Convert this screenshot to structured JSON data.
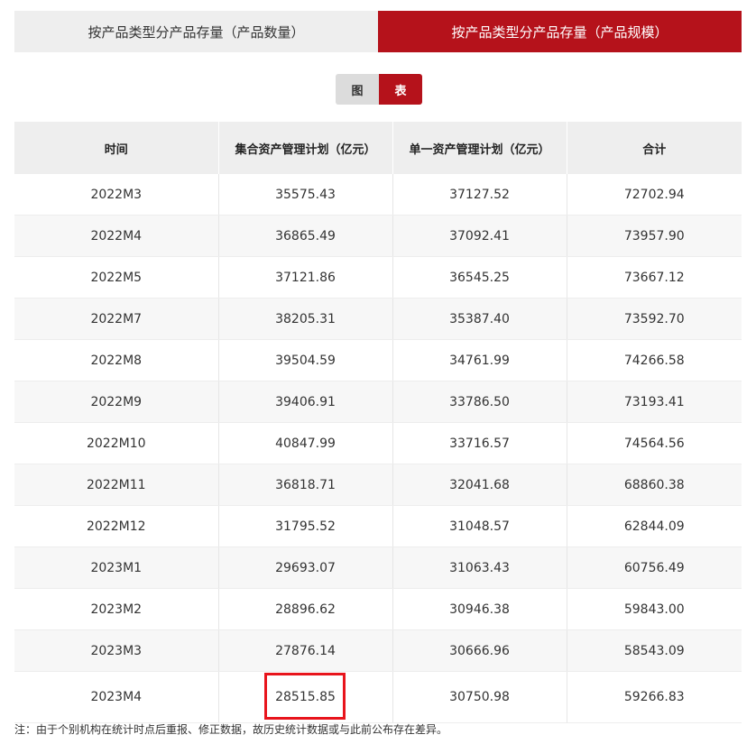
{
  "tabs": [
    {
      "label": "按产品类型分产品存量（产品数量）",
      "active": false
    },
    {
      "label": "按产品类型分产品存量（产品规模）",
      "active": true
    }
  ],
  "view_toggle": {
    "chart_label": "图",
    "table_label": "表",
    "selected": "表"
  },
  "colors": {
    "accent": "#b5121b",
    "highlight": "#e8141c"
  },
  "table": {
    "headers": [
      "时间",
      "集合资产管理计划（亿元）",
      "单一资产管理计划（亿元）",
      "合计"
    ],
    "rows": [
      [
        "2022M3",
        "35575.43",
        "37127.52",
        "72702.94"
      ],
      [
        "2022M4",
        "36865.49",
        "37092.41",
        "73957.90"
      ],
      [
        "2022M5",
        "37121.86",
        "36545.25",
        "73667.12"
      ],
      [
        "2022M7",
        "38205.31",
        "35387.40",
        "73592.70"
      ],
      [
        "2022M8",
        "39504.59",
        "34761.99",
        "74266.58"
      ],
      [
        "2022M9",
        "39406.91",
        "33786.50",
        "73193.41"
      ],
      [
        "2022M10",
        "40847.99",
        "33716.57",
        "74564.56"
      ],
      [
        "2022M11",
        "36818.71",
        "32041.68",
        "68860.38"
      ],
      [
        "2022M12",
        "31795.52",
        "31048.57",
        "62844.09"
      ],
      [
        "2023M1",
        "29693.07",
        "31063.43",
        "60756.49"
      ],
      [
        "2023M2",
        "28896.62",
        "30946.38",
        "59843.00"
      ],
      [
        "2023M3",
        "27876.14",
        "30666.96",
        "58543.09"
      ],
      [
        "2023M4",
        "28515.85",
        "30750.98",
        "59266.83"
      ]
    ]
  },
  "note": "注：由于个别机构在统计时点后重报、修正数据，故历史统计数据或与此前公布存在差异。"
}
